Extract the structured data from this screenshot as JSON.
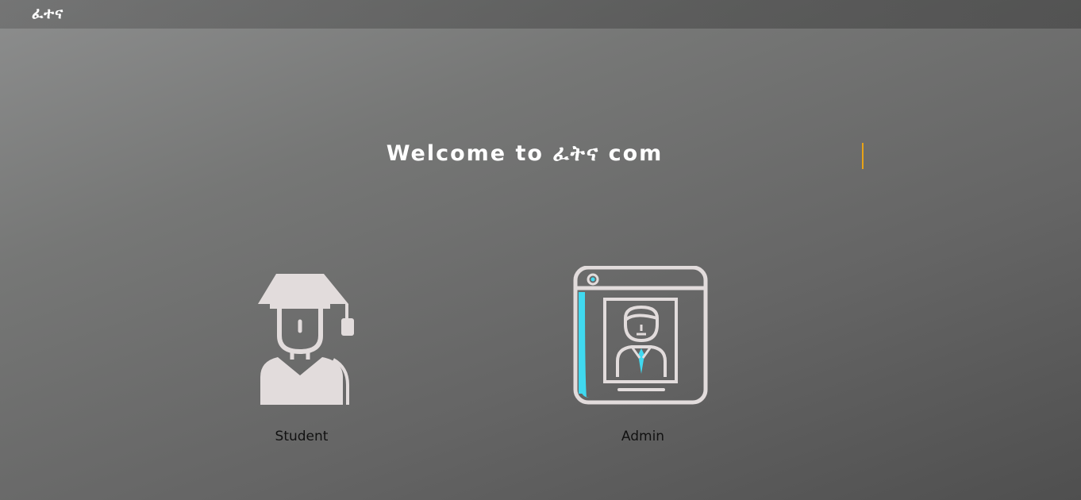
{
  "navbar": {
    "brand": "ፈተና"
  },
  "hero": {
    "welcome": "Welcome to ፈትና com"
  },
  "roles": [
    {
      "label": "Student",
      "icon": "graduate-student-icon"
    },
    {
      "label": "Admin",
      "icon": "admin-profile-window-icon"
    }
  ],
  "colors": {
    "icon_fill": "#e2dcdc",
    "accent_cyan": "#40d9f0",
    "cursor": "#e8a317"
  }
}
